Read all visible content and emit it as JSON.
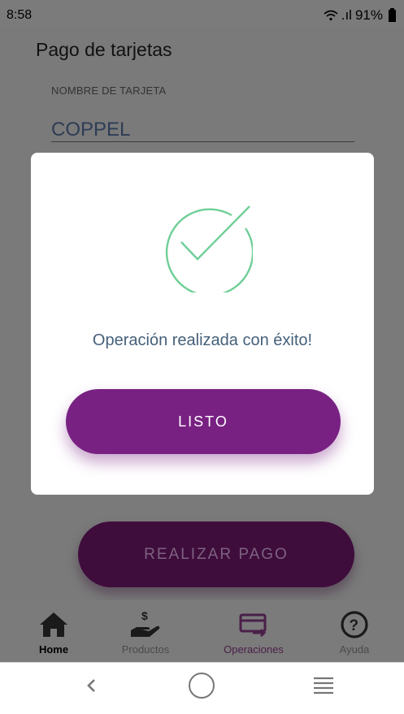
{
  "status_bar": {
    "time": "8:58",
    "battery": "91%",
    "signal": ".ıl"
  },
  "screen": {
    "title": "Pago de tarjetas",
    "card_field": {
      "label": "NOMBRE DE TARJETA",
      "value": "COPPEL"
    },
    "pay_button_label": "REALIZAR PAGO"
  },
  "modal": {
    "message": "Operación realizada con éxito!",
    "done_label": "LISTO",
    "icon": "check-circle-icon",
    "icon_color": "#6fcf97"
  },
  "tabs": [
    {
      "label": "Home",
      "icon": "home-icon"
    },
    {
      "label": "Productos",
      "icon": "hand-dollar-icon"
    },
    {
      "label": "Operaciones",
      "icon": "card-transfer-icon"
    },
    {
      "label": "Ayuda",
      "icon": "help-icon"
    }
  ],
  "colors": {
    "accent": "#782182",
    "overlay": "#7a7a7a",
    "message_text": "#45607a"
  }
}
